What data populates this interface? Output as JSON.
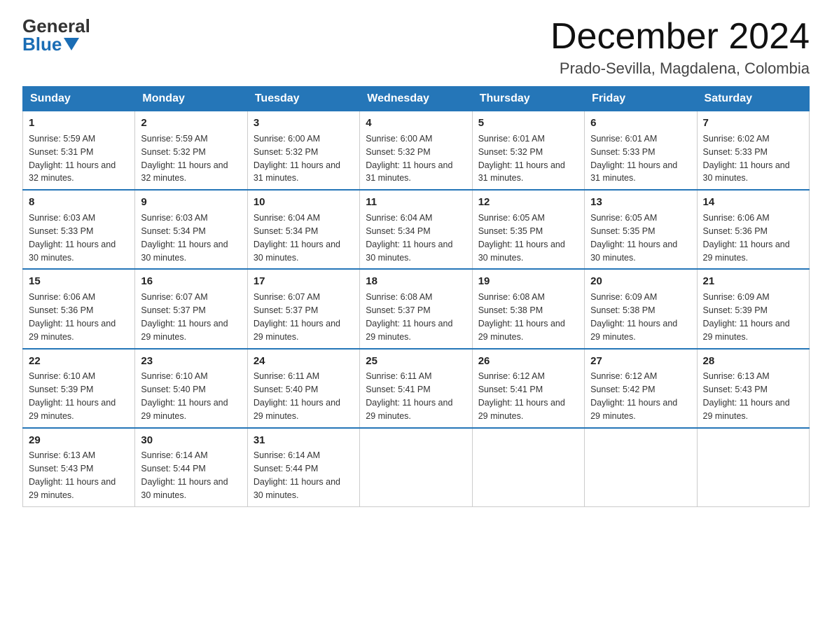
{
  "header": {
    "logo_general": "General",
    "logo_blue": "Blue",
    "title": "December 2024",
    "subtitle": "Prado-Sevilla, Magdalena, Colombia"
  },
  "days_of_week": [
    "Sunday",
    "Monday",
    "Tuesday",
    "Wednesday",
    "Thursday",
    "Friday",
    "Saturday"
  ],
  "weeks": [
    [
      {
        "day": "1",
        "sunrise": "5:59 AM",
        "sunset": "5:31 PM",
        "daylight": "11 hours and 32 minutes."
      },
      {
        "day": "2",
        "sunrise": "5:59 AM",
        "sunset": "5:32 PM",
        "daylight": "11 hours and 32 minutes."
      },
      {
        "day": "3",
        "sunrise": "6:00 AM",
        "sunset": "5:32 PM",
        "daylight": "11 hours and 31 minutes."
      },
      {
        "day": "4",
        "sunrise": "6:00 AM",
        "sunset": "5:32 PM",
        "daylight": "11 hours and 31 minutes."
      },
      {
        "day": "5",
        "sunrise": "6:01 AM",
        "sunset": "5:32 PM",
        "daylight": "11 hours and 31 minutes."
      },
      {
        "day": "6",
        "sunrise": "6:01 AM",
        "sunset": "5:33 PM",
        "daylight": "11 hours and 31 minutes."
      },
      {
        "day": "7",
        "sunrise": "6:02 AM",
        "sunset": "5:33 PM",
        "daylight": "11 hours and 30 minutes."
      }
    ],
    [
      {
        "day": "8",
        "sunrise": "6:03 AM",
        "sunset": "5:33 PM",
        "daylight": "11 hours and 30 minutes."
      },
      {
        "day": "9",
        "sunrise": "6:03 AM",
        "sunset": "5:34 PM",
        "daylight": "11 hours and 30 minutes."
      },
      {
        "day": "10",
        "sunrise": "6:04 AM",
        "sunset": "5:34 PM",
        "daylight": "11 hours and 30 minutes."
      },
      {
        "day": "11",
        "sunrise": "6:04 AM",
        "sunset": "5:34 PM",
        "daylight": "11 hours and 30 minutes."
      },
      {
        "day": "12",
        "sunrise": "6:05 AM",
        "sunset": "5:35 PM",
        "daylight": "11 hours and 30 minutes."
      },
      {
        "day": "13",
        "sunrise": "6:05 AM",
        "sunset": "5:35 PM",
        "daylight": "11 hours and 30 minutes."
      },
      {
        "day": "14",
        "sunrise": "6:06 AM",
        "sunset": "5:36 PM",
        "daylight": "11 hours and 29 minutes."
      }
    ],
    [
      {
        "day": "15",
        "sunrise": "6:06 AM",
        "sunset": "5:36 PM",
        "daylight": "11 hours and 29 minutes."
      },
      {
        "day": "16",
        "sunrise": "6:07 AM",
        "sunset": "5:37 PM",
        "daylight": "11 hours and 29 minutes."
      },
      {
        "day": "17",
        "sunrise": "6:07 AM",
        "sunset": "5:37 PM",
        "daylight": "11 hours and 29 minutes."
      },
      {
        "day": "18",
        "sunrise": "6:08 AM",
        "sunset": "5:37 PM",
        "daylight": "11 hours and 29 minutes."
      },
      {
        "day": "19",
        "sunrise": "6:08 AM",
        "sunset": "5:38 PM",
        "daylight": "11 hours and 29 minutes."
      },
      {
        "day": "20",
        "sunrise": "6:09 AM",
        "sunset": "5:38 PM",
        "daylight": "11 hours and 29 minutes."
      },
      {
        "day": "21",
        "sunrise": "6:09 AM",
        "sunset": "5:39 PM",
        "daylight": "11 hours and 29 minutes."
      }
    ],
    [
      {
        "day": "22",
        "sunrise": "6:10 AM",
        "sunset": "5:39 PM",
        "daylight": "11 hours and 29 minutes."
      },
      {
        "day": "23",
        "sunrise": "6:10 AM",
        "sunset": "5:40 PM",
        "daylight": "11 hours and 29 minutes."
      },
      {
        "day": "24",
        "sunrise": "6:11 AM",
        "sunset": "5:40 PM",
        "daylight": "11 hours and 29 minutes."
      },
      {
        "day": "25",
        "sunrise": "6:11 AM",
        "sunset": "5:41 PM",
        "daylight": "11 hours and 29 minutes."
      },
      {
        "day": "26",
        "sunrise": "6:12 AM",
        "sunset": "5:41 PM",
        "daylight": "11 hours and 29 minutes."
      },
      {
        "day": "27",
        "sunrise": "6:12 AM",
        "sunset": "5:42 PM",
        "daylight": "11 hours and 29 minutes."
      },
      {
        "day": "28",
        "sunrise": "6:13 AM",
        "sunset": "5:43 PM",
        "daylight": "11 hours and 29 minutes."
      }
    ],
    [
      {
        "day": "29",
        "sunrise": "6:13 AM",
        "sunset": "5:43 PM",
        "daylight": "11 hours and 29 minutes."
      },
      {
        "day": "30",
        "sunrise": "6:14 AM",
        "sunset": "5:44 PM",
        "daylight": "11 hours and 30 minutes."
      },
      {
        "day": "31",
        "sunrise": "6:14 AM",
        "sunset": "5:44 PM",
        "daylight": "11 hours and 30 minutes."
      },
      null,
      null,
      null,
      null
    ]
  ],
  "labels": {
    "sunrise": "Sunrise:",
    "sunset": "Sunset:",
    "daylight": "Daylight:"
  }
}
